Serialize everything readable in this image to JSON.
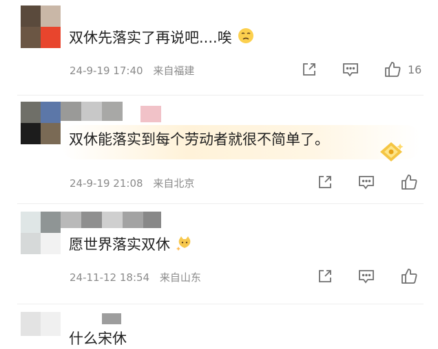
{
  "comments": [
    {
      "text": "双休先落实了再说吧....唉",
      "emoji": "sad-face-emoji",
      "time": "24-9-19 17:40",
      "location": "来自福建",
      "likes": "16"
    },
    {
      "text": "双休能落实到每个劳动者就很不简单了。",
      "badge": "gold-rank-badge",
      "time": "24-9-19 21:08",
      "location": "来自北京"
    },
    {
      "text": "愿世界落实双休",
      "emoji": "sparkle-cat-emoji",
      "time": "24-11-12 18:54",
      "location": "来自山东"
    },
    {
      "text": "什么宋休"
    }
  ],
  "colors": {
    "meta_text": "#8a8a8a",
    "icon_stroke": "#6f6f6f",
    "highlight": "#fff0d2"
  }
}
